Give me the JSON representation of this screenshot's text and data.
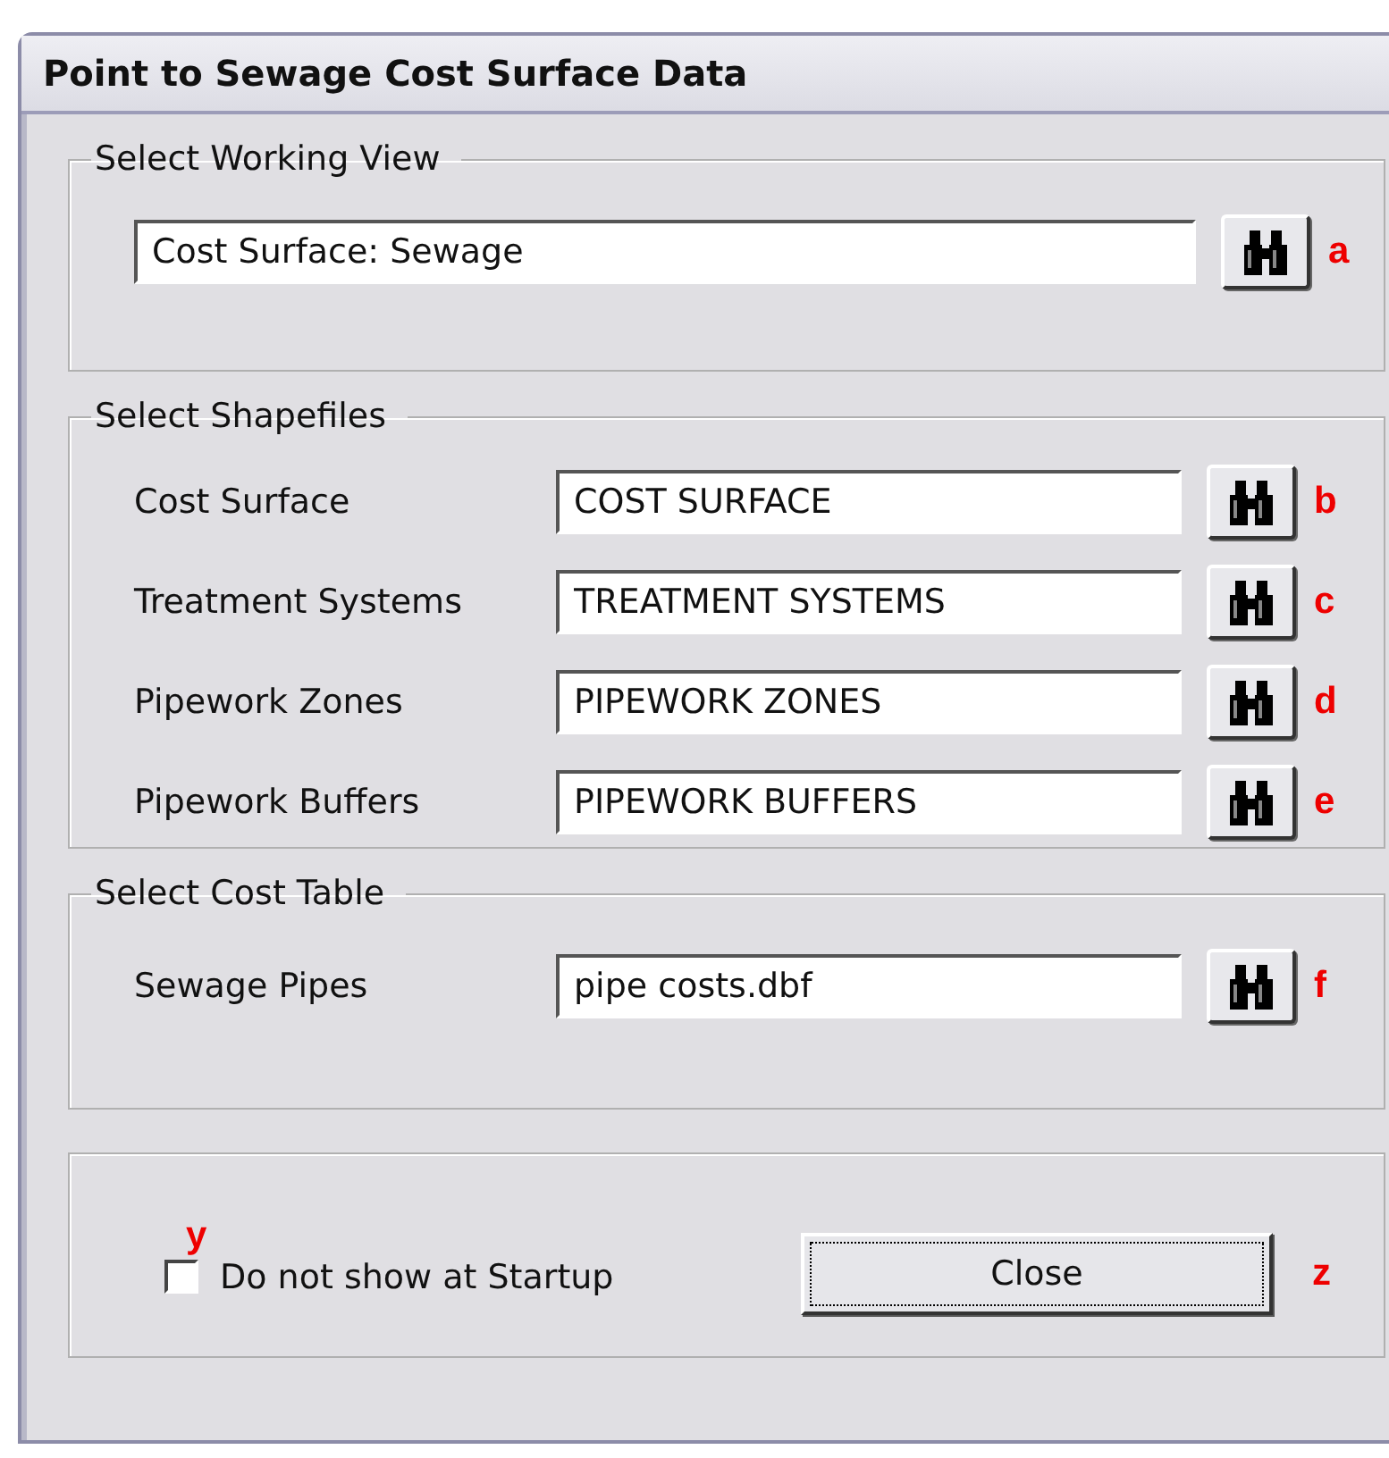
{
  "window": {
    "title": "Point to Sewage Cost Surface Data"
  },
  "working_view": {
    "legend": "Select Working View",
    "value": "Cost Surface: Sewage",
    "marker": "a"
  },
  "shapefiles": {
    "legend": "Select Shapefiles",
    "rows": [
      {
        "label": "Cost Surface",
        "value": "COST SURFACE",
        "marker": "b"
      },
      {
        "label": "Treatment Systems",
        "value": "TREATMENT SYSTEMS",
        "marker": "c"
      },
      {
        "label": "Pipework Zones",
        "value": "PIPEWORK ZONES",
        "marker": "d"
      },
      {
        "label": "Pipework Buffers",
        "value": "PIPEWORK BUFFERS",
        "marker": "e"
      }
    ]
  },
  "cost_table": {
    "legend": "Select Cost Table",
    "rows": [
      {
        "label": "Sewage Pipes",
        "value": "pipe costs.dbf",
        "marker": "f"
      }
    ]
  },
  "footer": {
    "checkbox": {
      "label": "Do not show at Startup",
      "checked": false,
      "marker": "y"
    },
    "close_button": {
      "label": "Close",
      "marker": "z"
    }
  }
}
